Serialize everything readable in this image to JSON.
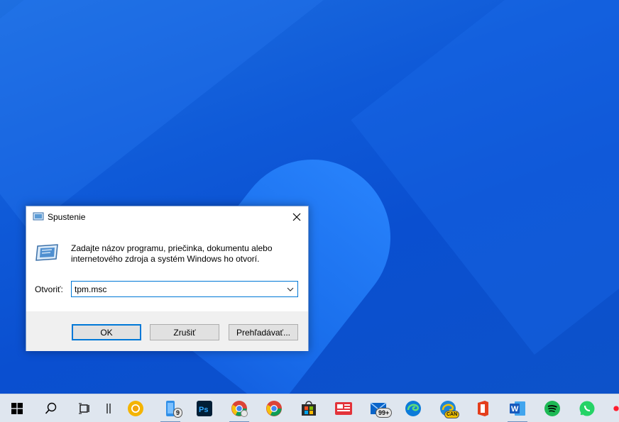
{
  "dialog": {
    "title": "Spustenie",
    "description_line1": "Zadajte názov programu, priečinka, dokumentu alebo",
    "description_line2": "internetového zdroja a systém Windows ho otvorí.",
    "open_label": "Otvoriť:",
    "input_value": "tpm.msc",
    "buttons": {
      "ok": "OK",
      "cancel": "Zrušiť",
      "browse": "Prehľadávať..."
    }
  },
  "taskbar": {
    "badges": {
      "phone": "9",
      "mail": "99+",
      "edge_canary": "CAN"
    }
  },
  "colors": {
    "accent": "#0078d7",
    "desktop": "#0f5ad8",
    "taskbar": "#dfe6ef"
  }
}
